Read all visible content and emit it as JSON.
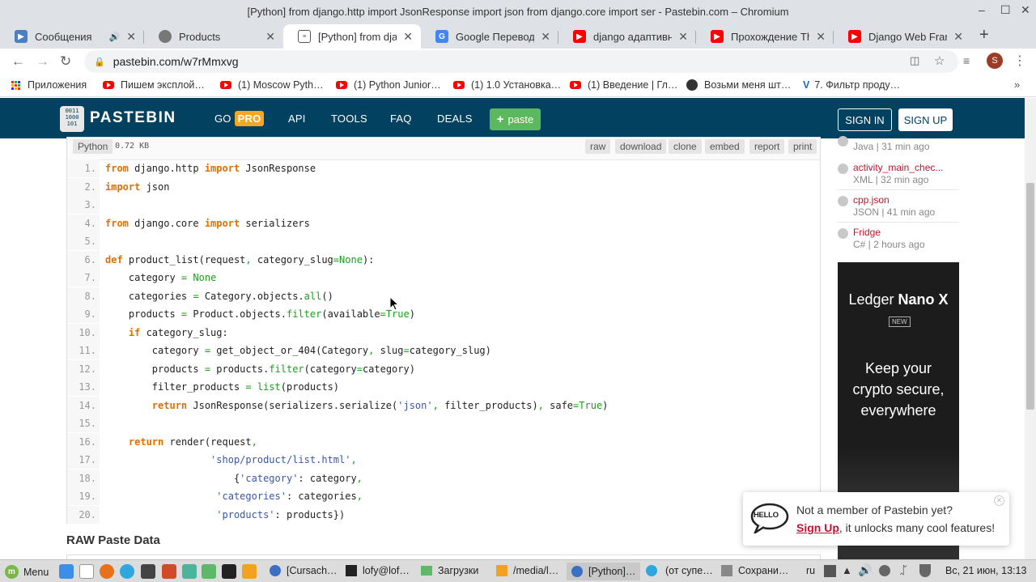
{
  "window": {
    "title": "[Python] from django.http import JsonResponse import json from django.core import ser - Pastebin.com – Chromium"
  },
  "tabs": [
    {
      "label": "Сообщения",
      "color": "#4a7fc1"
    },
    {
      "label": "Products",
      "color": "#777777"
    },
    {
      "label": "[Python] from djang",
      "color": "#555555"
    },
    {
      "label": "Google Переводчик",
      "color": "#4285f4"
    },
    {
      "label": "django адаптивный",
      "color": "#ff0000"
    },
    {
      "label": "Прохождение The L",
      "color": "#ff0000"
    },
    {
      "label": "Django Web Framew",
      "color": "#ff0000"
    }
  ],
  "address": {
    "url": "pastebin.com/w7rMmxvg"
  },
  "bookmarks": [
    {
      "label": "Приложения"
    },
    {
      "label": "Пишем эксплой…"
    },
    {
      "label": "(1) Moscow Pyth…"
    },
    {
      "label": "(1) Python Junior…"
    },
    {
      "label": "(1) 1.0 Установка…"
    },
    {
      "label": "(1) Введение | Гл…"
    },
    {
      "label": "Возьми меня шт…"
    },
    {
      "label": "7. Фильтр проду…"
    }
  ],
  "header": {
    "logo": "PASTEBIN",
    "go": "GO",
    "pro": "PRO",
    "api": "API",
    "tools": "TOOLS",
    "faq": "FAQ",
    "deals": "DEALS",
    "paste": "paste",
    "sign_in": "SIGN IN",
    "sign_up": "SIGN UP"
  },
  "paste": {
    "language": "Python",
    "size": "0.72 KB",
    "actions": [
      "raw",
      "download",
      "clone",
      "embed",
      "report",
      "print"
    ],
    "raw_title": "RAW Paste Data"
  },
  "sidebar": [
    {
      "name": "",
      "meta": "Java | 31 min ago"
    },
    {
      "name": "activity_main_chec...",
      "meta": "XML | 32 min ago"
    },
    {
      "name": "cpp.json",
      "meta": "JSON | 41 min ago"
    },
    {
      "name": "Fridge",
      "meta": "C# | 2 hours ago"
    }
  ],
  "ad": {
    "brand_light": "Ledger ",
    "brand_bold": "Nano X",
    "badge": "NEW",
    "line1": "Keep your",
    "line2": "crypto secure,",
    "line3": "everywhere"
  },
  "toast": {
    "badge": "HELLO",
    "line1": "Not a member of Pastebin yet?",
    "signup": "Sign Up",
    "rest": ", it unlocks many cool features!"
  },
  "taskbar": {
    "menu": "Menu",
    "items": [
      "[Cursach…",
      "lofy@lof…",
      "Загрузки",
      "/media/l…",
      "[Python]…",
      "(от супе…",
      "Сохрани…"
    ],
    "lang": "ru",
    "clock": "Вс, 21 июн, 13:13"
  }
}
